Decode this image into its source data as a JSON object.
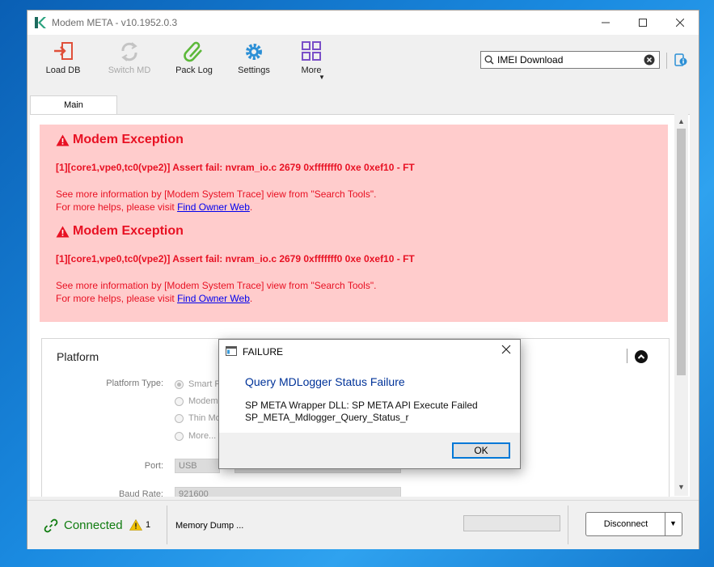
{
  "window": {
    "title": "Modem META - v10.1952.0.3"
  },
  "toolbar": {
    "load_db": "Load DB",
    "switch_md": "Switch MD",
    "pack_log": "Pack Log",
    "settings": "Settings",
    "more": "More"
  },
  "search": {
    "value": "IMEI Download"
  },
  "tabs": [
    {
      "label": "Main"
    }
  ],
  "exceptions": [
    {
      "title": "Modem Exception",
      "assert": "[1][core1,vpe0,tc0(vpe2)] Assert fail: nvram_io.c 2679 0xfffffff0 0xe 0xef10 - FT",
      "info_line1": "See more information by [Modem System Trace] view from \"Search Tools\".",
      "info_line2_prefix": "For more helps, please visit ",
      "info_link": "Find Owner Web",
      "info_line2_suffix": "."
    },
    {
      "title": "Modem Exception",
      "assert": "[1][core1,vpe0,tc0(vpe2)] Assert fail: nvram_io.c 2679 0xfffffff0 0xe 0xef10 - FT",
      "info_line1": "See more information by [Modem System Trace] view from \"Search Tools\".",
      "info_line2_prefix": "For more helps, please visit ",
      "info_link": "Find Owner Web",
      "info_line2_suffix": "."
    }
  ],
  "platform": {
    "title": "Platform",
    "type_label": "Platform Type:",
    "options": [
      "Smart P",
      "Modem",
      "Thin Mo",
      "More..."
    ],
    "port_label": "Port:",
    "port_value": "USB",
    "baud_label": "Baud Rate:",
    "baud_value": "921600"
  },
  "status": {
    "connection": "Connected",
    "warning_count": "1",
    "message": "Memory Dump ...",
    "disconnect_label": "Disconnect"
  },
  "dialog": {
    "title": "FAILURE",
    "heading": "Query MDLogger Status Failure",
    "line1": "SP META Wrapper DLL: SP META API Execute Failed",
    "line2": "SP_META_Mdlogger_Query_Status_r",
    "ok_label": "OK"
  },
  "colors": {
    "exception_bg": "#ffcccc",
    "exception_text": "#e81123",
    "connected": "#107c10",
    "dialog_heading": "#003399",
    "focus": "#0078d7"
  }
}
